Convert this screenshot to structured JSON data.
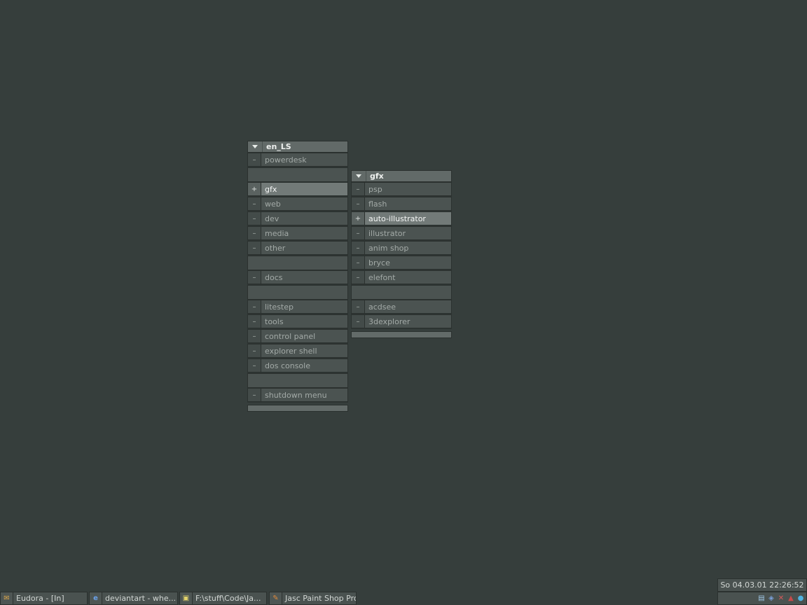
{
  "menus": {
    "main": {
      "title": "en_LS",
      "rows": [
        {
          "sym": "–",
          "label": "powerdesk"
        },
        {
          "sep": true
        },
        {
          "sym": "+",
          "label": "gfx",
          "hl": true
        },
        {
          "sym": "–",
          "label": "web"
        },
        {
          "sym": "–",
          "label": "dev"
        },
        {
          "sym": "–",
          "label": "media"
        },
        {
          "sym": "–",
          "label": "other"
        },
        {
          "sep": true
        },
        {
          "sym": "–",
          "label": "docs"
        },
        {
          "sep": true
        },
        {
          "sym": "–",
          "label": "litestep"
        },
        {
          "sym": "–",
          "label": "tools"
        },
        {
          "sym": "–",
          "label": "control panel"
        },
        {
          "sym": "–",
          "label": "explorer shell"
        },
        {
          "sym": "–",
          "label": "dos console"
        },
        {
          "sep": true
        },
        {
          "sym": "–",
          "label": "shutdown menu"
        }
      ]
    },
    "gfx": {
      "title": "gfx",
      "rows": [
        {
          "sym": "–",
          "label": "psp"
        },
        {
          "sym": "–",
          "label": "flash"
        },
        {
          "sym": "+",
          "label": "auto-illustrator",
          "hl": true
        },
        {
          "sym": "–",
          "label": "illustrator"
        },
        {
          "sym": "–",
          "label": "anim shop"
        },
        {
          "sym": "–",
          "label": "bryce"
        },
        {
          "sym": "–",
          "label": "elefont"
        },
        {
          "sep": true
        },
        {
          "sym": "–",
          "label": "acdsee"
        },
        {
          "sym": "–",
          "label": "3dexplorer"
        }
      ]
    }
  },
  "taskbar": {
    "tasks": [
      {
        "icon": "eudora-icon",
        "glyph": "✉",
        "label": "Eudora - [In]"
      },
      {
        "icon": "internet-explorer-icon",
        "glyph": "e",
        "label": "deviantart - whe..."
      },
      {
        "icon": "folder-icon",
        "glyph": "▣",
        "label": "F:\\stuff\\Code\\Ja..."
      },
      {
        "icon": "paint-shop-pro-icon",
        "glyph": "✎",
        "label": "Jasc Paint Shop Pro"
      }
    ],
    "clock": "So 04.03.01 22:26:52",
    "tray_icons": [
      {
        "icon": "network-tray-icon",
        "glyph": "▤"
      },
      {
        "icon": "volume-tray-icon",
        "glyph": "◈"
      },
      {
        "icon": "tools-tray-icon",
        "glyph": "✕"
      },
      {
        "icon": "antivirus-tray-icon",
        "glyph": "▲"
      },
      {
        "icon": "globe-tray-icon",
        "glyph": "●"
      }
    ]
  }
}
